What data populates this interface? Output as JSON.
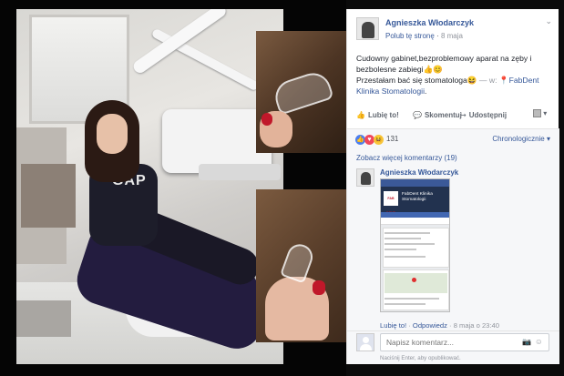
{
  "post": {
    "author": "Agnieszka Włodarczyk",
    "follow_label": "Polub tę stronę",
    "dot": "·",
    "date": "8 maja",
    "chevron": "⌄",
    "text_line1": "Cudowny gabinet,bezproblemowy aparat na zęby i",
    "text_line2": "bezbolesne zabiegi👍😊",
    "text_line3": "Przestałam bać się stomatologa😆",
    "location_prefix": "— w:",
    "location_pin": "📍",
    "location_name": "FabDent Klinika Stomatologii",
    "location_suffix": "."
  },
  "actions": {
    "like_icon": "👍",
    "like_label": "Lubię to!",
    "comment_icon": "💬",
    "comment_label": "Skomentuj",
    "share_icon": "↪",
    "share_label": "Udostępnij",
    "menu_caret": "▾"
  },
  "reactions": {
    "like_icon": "👍",
    "love_icon": "♥",
    "haha_icon": "😆",
    "count": "131",
    "sort_label": "Chronologicznie ▾"
  },
  "comments": {
    "more_label": "Zobacz więcej komentarzy (19)",
    "items": [
      {
        "author": "Agnieszka Włodarczyk",
        "shot_logo": "FAB DENT",
        "shot_title": "FabDent Klinika Stomatologii",
        "like_label": "Lubię to!",
        "separator": "·",
        "reply_label": "Odpowiedz",
        "time": "8 maja o 23:40"
      }
    ]
  },
  "compose": {
    "placeholder": "Napisz komentarz...",
    "camera_icon": "📷",
    "emoji_icon": "☺",
    "hint": "Naciśnij Enter, aby opublikować."
  },
  "photo": {
    "shirt_text": "GAP"
  },
  "colors": {
    "link": "#365899",
    "meta": "#90949c",
    "background": "#0b0b0b"
  }
}
